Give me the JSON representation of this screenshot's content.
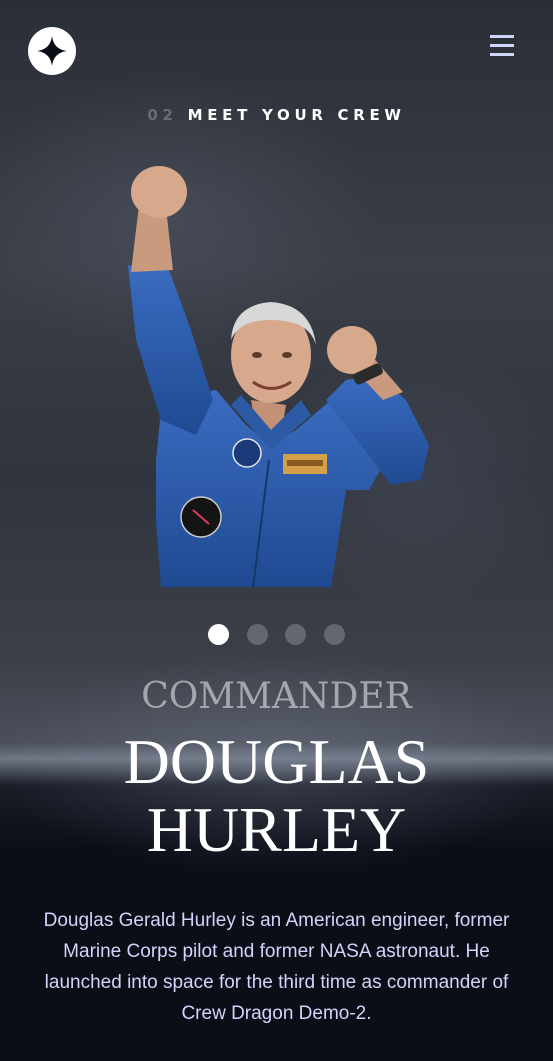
{
  "header": {
    "logo_icon": "star-logo-icon",
    "menu_icon": "hamburger-menu-icon"
  },
  "section": {
    "number": "02",
    "title": "MEET YOUR CREW"
  },
  "crew": {
    "role": "COMMANDER",
    "name_line1": "DOUGLAS",
    "name_line2": "HURLEY",
    "bio": "Douglas Gerald Hurley is an American engineer, former Marine Corps pilot and former NASA astronaut. He launched into space for the third time as commander of Crew Dragon Demo-2."
  },
  "pagination": {
    "total": 4,
    "active_index": 0
  },
  "colors": {
    "background": "#0b0d17",
    "accent_light": "#d0d6f9",
    "suit_blue": "#2a5aa8"
  }
}
